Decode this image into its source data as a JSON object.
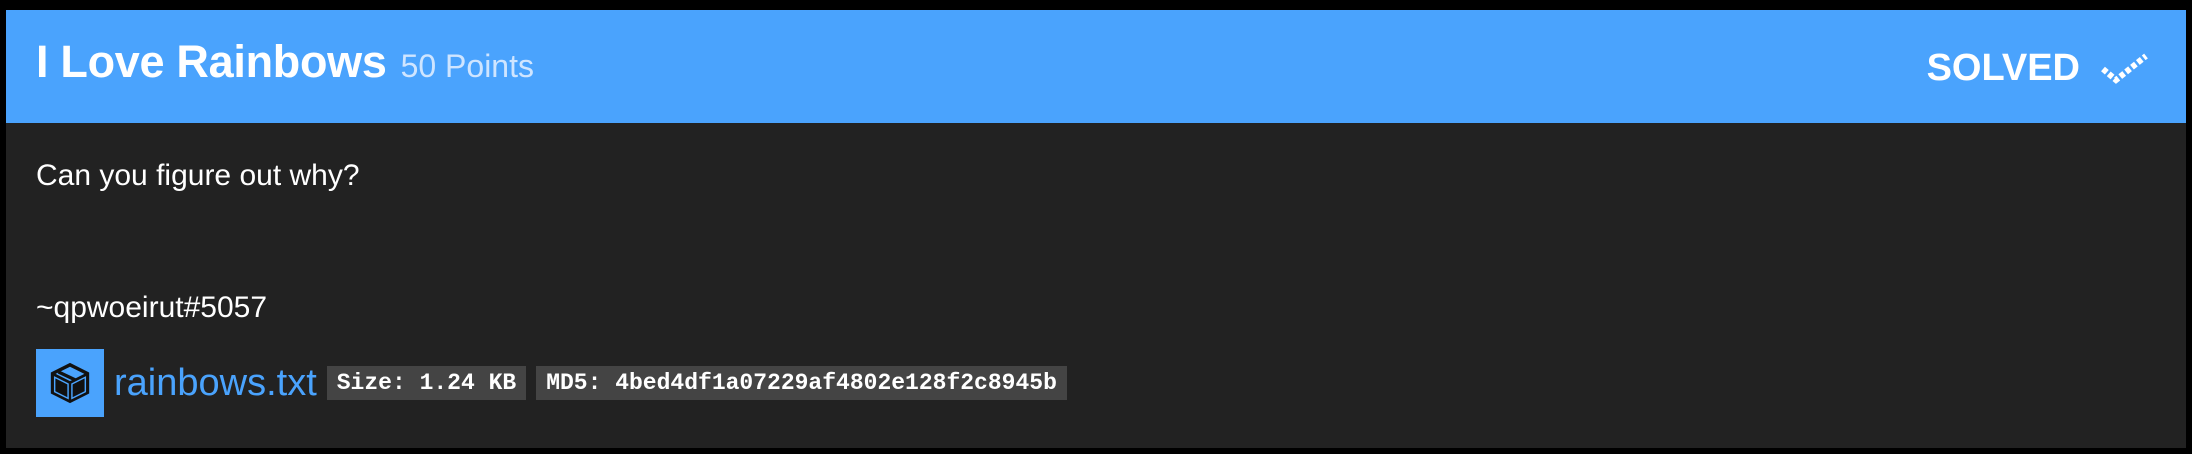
{
  "challenge": {
    "title": "I Love Rainbows",
    "points_label": "50 Points",
    "status": "SOLVED",
    "status_icon": "checkmark-icon",
    "description": "Can you figure out why?",
    "author": "~qpwoeirut#5057"
  },
  "file": {
    "icon": "package-icon",
    "name": "rainbows.txt",
    "size_label": "Size: 1.24 KB",
    "md5_label": "MD5: 4bed4df1a07229af4802e128f2c8945b"
  },
  "colors": {
    "accent": "#4aa3fd",
    "card_background": "#222222",
    "page_background": "#000000",
    "tag_background": "#444444",
    "points_text": "#cfe5ff"
  }
}
